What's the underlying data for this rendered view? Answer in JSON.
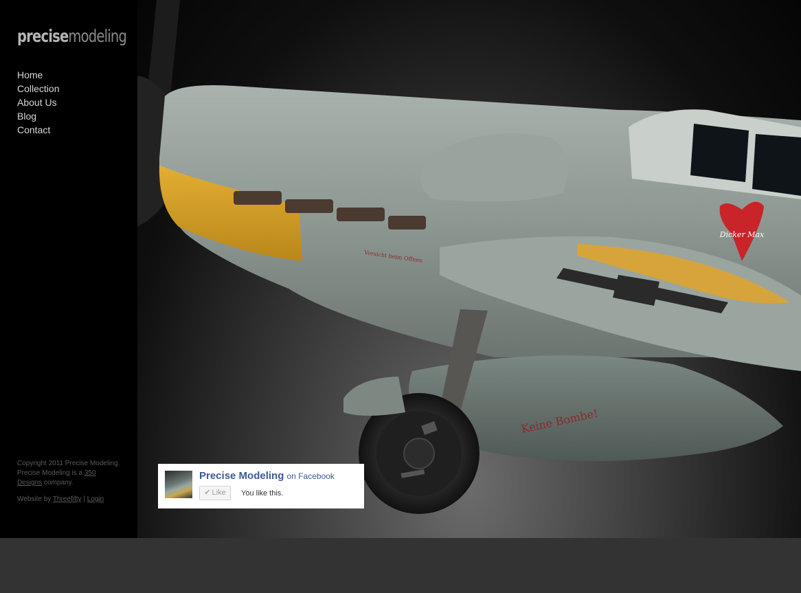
{
  "logo": {
    "part1": "precise",
    "part2": "modeling"
  },
  "nav": {
    "items": [
      {
        "label": "Home"
      },
      {
        "label": "Collection"
      },
      {
        "label": "About Us"
      },
      {
        "label": "Blog"
      },
      {
        "label": "Contact"
      }
    ]
  },
  "footer": {
    "copyright_prefix": "Copyright 2011 Precise Modeling. Precise Modeling is a",
    "company_link": "350 Designs",
    "copyright_suffix": "company.",
    "credit_prefix": "Website by",
    "credit_link": "Threefifty",
    "separator": "|",
    "login_link": "Login"
  },
  "hero": {
    "plane_texts": {
      "kennzeichen": "Dicker Max",
      "bomb_text": "Keine Bombe!",
      "warning": "Vorsicht beim Offnen"
    },
    "colors": {
      "fuselage": "#8e9893",
      "nose_yellow": "#d8a22a",
      "background": "#0a0a0a"
    }
  },
  "facebook": {
    "page_name": "Precise Modeling",
    "on_text": "on Facebook",
    "like_label": "Like",
    "status": "You like this."
  },
  "colors": {
    "sidebar": "#000000",
    "page_bg": "#333333",
    "fb_blue": "#3b5998"
  }
}
